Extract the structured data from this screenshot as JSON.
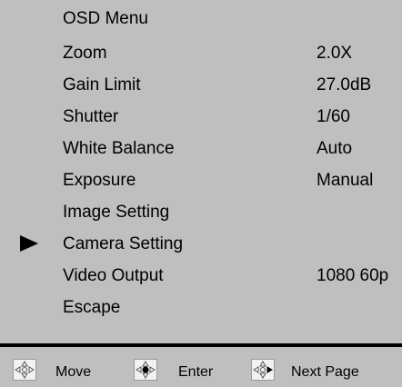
{
  "menu": {
    "title": "OSD Menu",
    "items": [
      {
        "label": "Zoom",
        "value": "2.0X"
      },
      {
        "label": "Gain Limit",
        "value": "27.0dB"
      },
      {
        "label": "Shutter",
        "value": "1/60"
      },
      {
        "label": "White Balance",
        "value": "Auto"
      },
      {
        "label": "Exposure",
        "value": "Manual"
      },
      {
        "label": "Image Setting",
        "value": ""
      },
      {
        "label": "Camera Setting",
        "value": "",
        "selected": true
      },
      {
        "label": "Video Output",
        "value": "1080 60p"
      },
      {
        "label": "Escape",
        "value": ""
      }
    ],
    "pointer_icon": "triangle-right-icon"
  },
  "footer": {
    "hints": [
      {
        "label": "Move",
        "icon": "dpad-arrows-icon"
      },
      {
        "label": "Enter",
        "icon": "dpad-center-icon"
      },
      {
        "label": "Next Page",
        "icon": "dpad-right-icon"
      }
    ]
  },
  "colors": {
    "background": "#bfbfbf",
    "text": "#000000",
    "divider": "#000000"
  }
}
